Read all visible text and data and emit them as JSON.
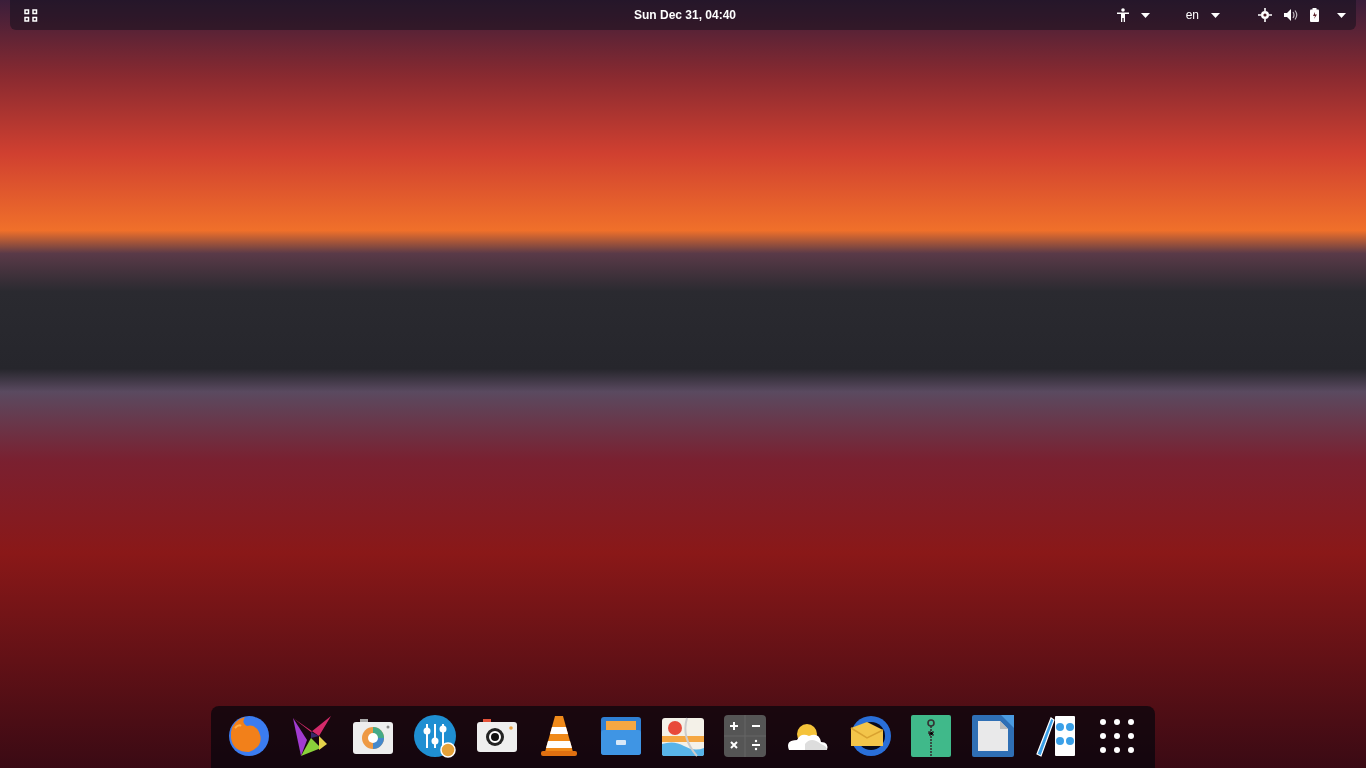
{
  "top_bar": {
    "clock": "Sun Dec 31, 04:40",
    "language": "en"
  }
}
